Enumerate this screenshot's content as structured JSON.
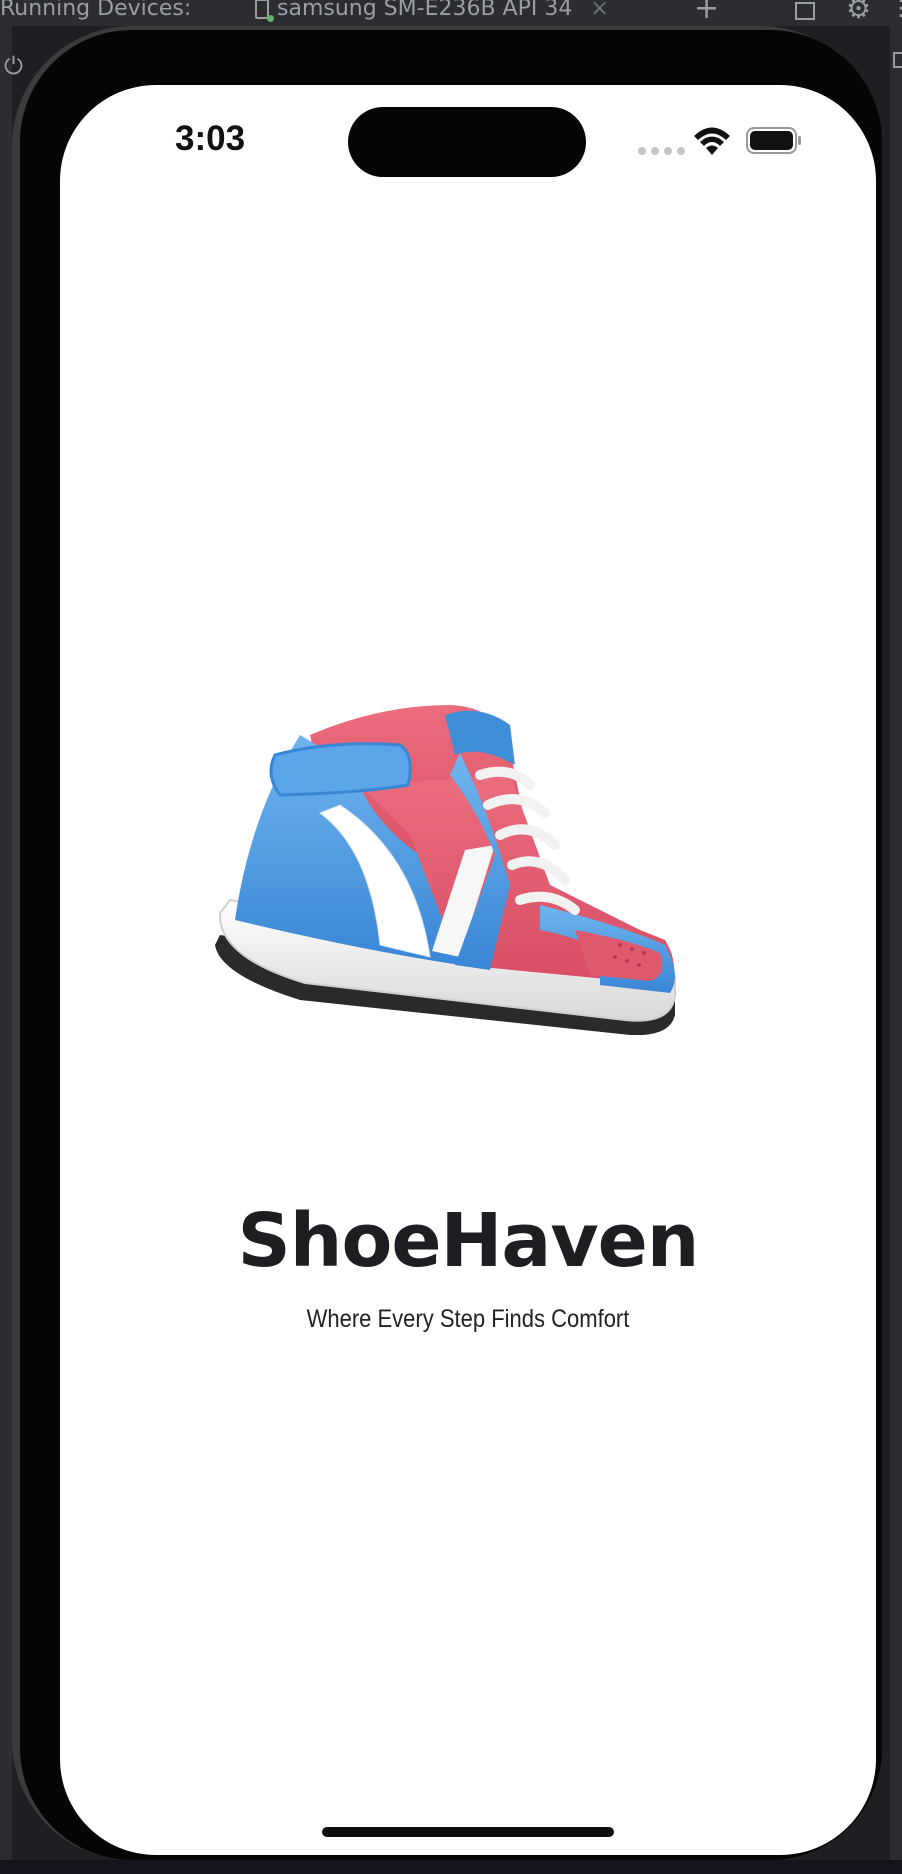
{
  "ide": {
    "panel_label": "Running Devices:",
    "device_tab": "samsung SM-E236B API 34",
    "close_glyph": "×",
    "add_glyph": "+",
    "icons": [
      "device-icon",
      "plus-icon",
      "window-icon",
      "gear-icon",
      "power-icon"
    ]
  },
  "status_bar": {
    "time": "3:03",
    "icons": [
      "signal-dots-icon",
      "wifi-icon",
      "battery-icon"
    ]
  },
  "splash": {
    "image": "sneaker-illustration",
    "brand_name": "ShoeHaven",
    "tagline": "Where Every Step Finds Comfort"
  },
  "colors": {
    "brand_text": "#1c1e21",
    "shoe_blue": "#4a9be0",
    "shoe_red": "#e05a6d",
    "screen_bg": "#ffffff"
  }
}
